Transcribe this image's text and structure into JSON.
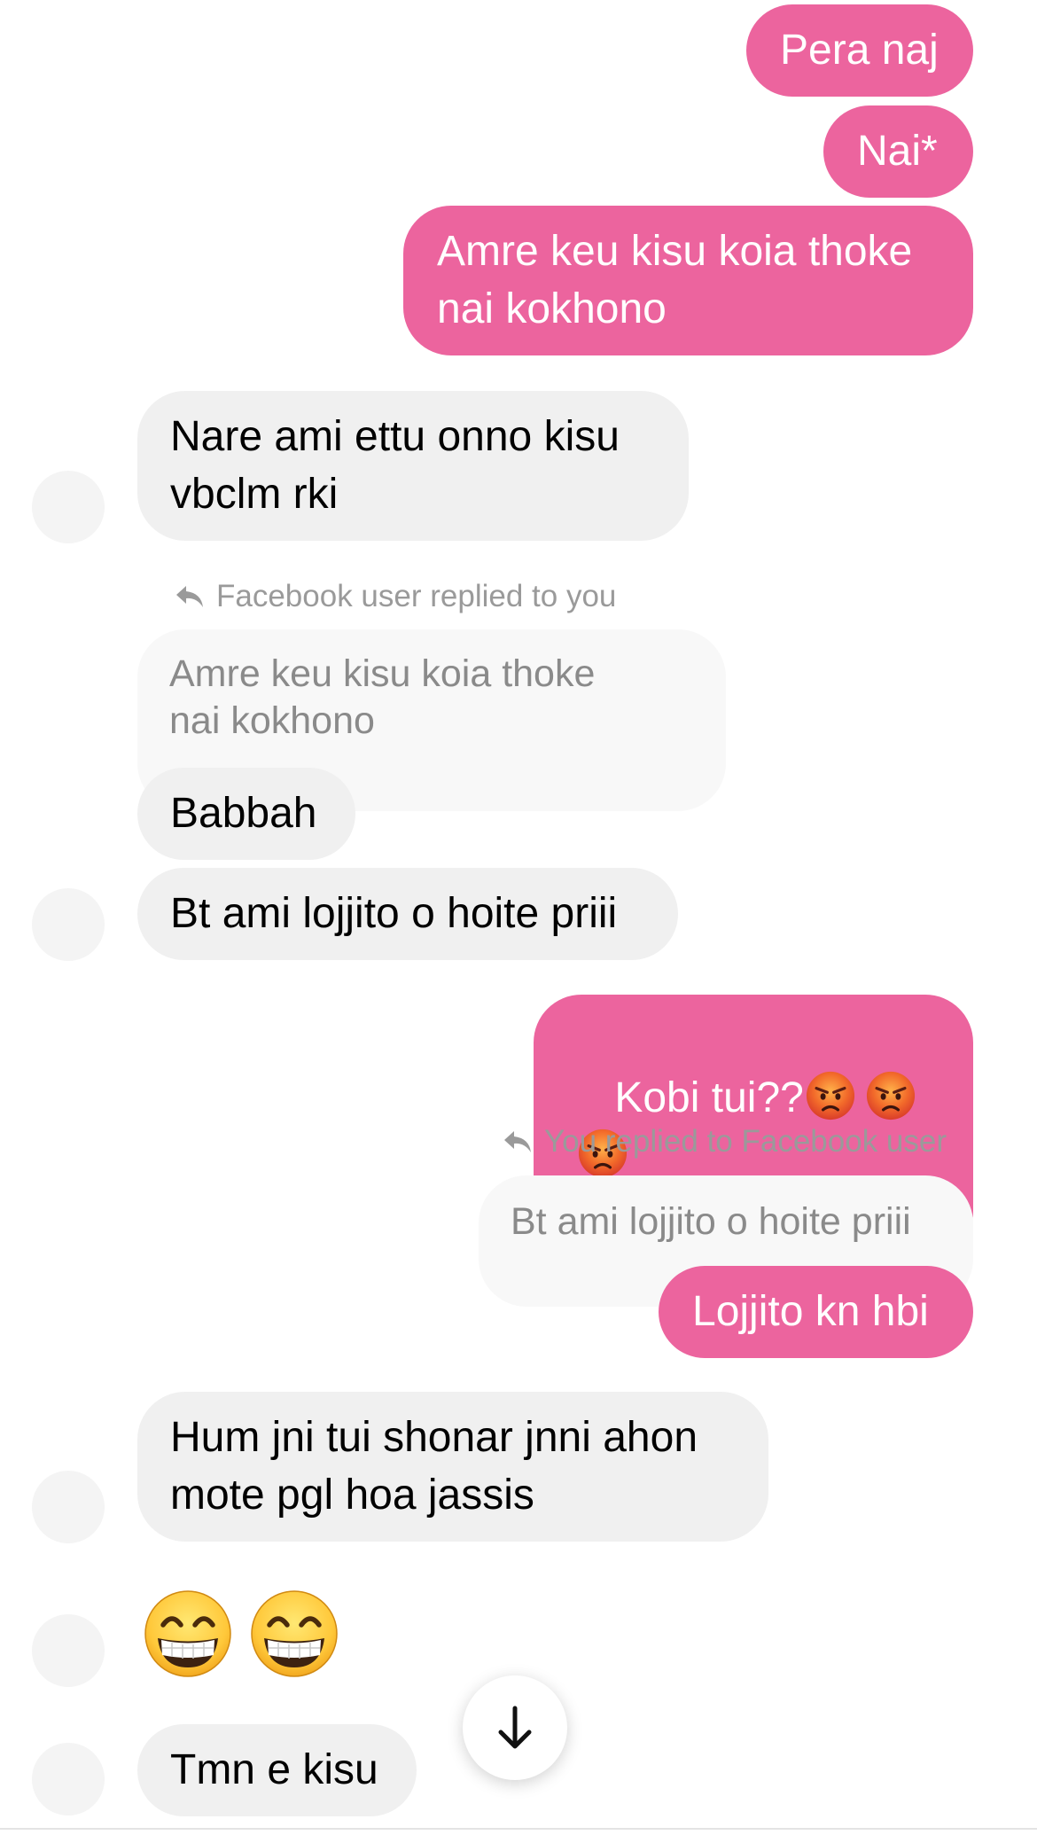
{
  "messages": [
    {
      "from": "me",
      "text": "Pera naj"
    },
    {
      "from": "me",
      "text": "Nai*"
    },
    {
      "from": "me",
      "text": "Amre keu kisu koia thoke\nnai kokhono"
    },
    {
      "from": "them",
      "text": "Nare ami ettu onno kisu\nvbclm rki"
    },
    {
      "from": "them",
      "reply_label": "Facebook user replied to you",
      "quoted": "Amre keu kisu koia thoke\nnai kokhono",
      "text": "Babbah"
    },
    {
      "from": "them",
      "text": "Bt ami lojjito o hoite priii"
    },
    {
      "from": "me",
      "text": "Kobi tui??",
      "emojis": [
        "pouting-face",
        "pouting-face",
        "pouting-face"
      ]
    },
    {
      "from": "me",
      "reply_label": "You replied to Facebook user",
      "quoted": "Bt ami lojjito o hoite priii",
      "text": "Lojjito kn hbi"
    },
    {
      "from": "them",
      "text": "Hum jni tui shonar jnni ahon\nmote pgl hoa jassis"
    },
    {
      "from": "them",
      "emojis": [
        "grinning-face-with-smiling-eyes",
        "grinning-face-with-smiling-eyes"
      ]
    },
    {
      "from": "them",
      "text": "Tmn e kisu"
    }
  ],
  "scroll_button": {
    "icon": "arrow-down-icon"
  },
  "colors": {
    "outgoing_bubble": "#ec649e",
    "incoming_bubble": "#f0f0f0",
    "quoted_bubble": "#f8f8f8",
    "reply_label": "#9a9a9a"
  }
}
